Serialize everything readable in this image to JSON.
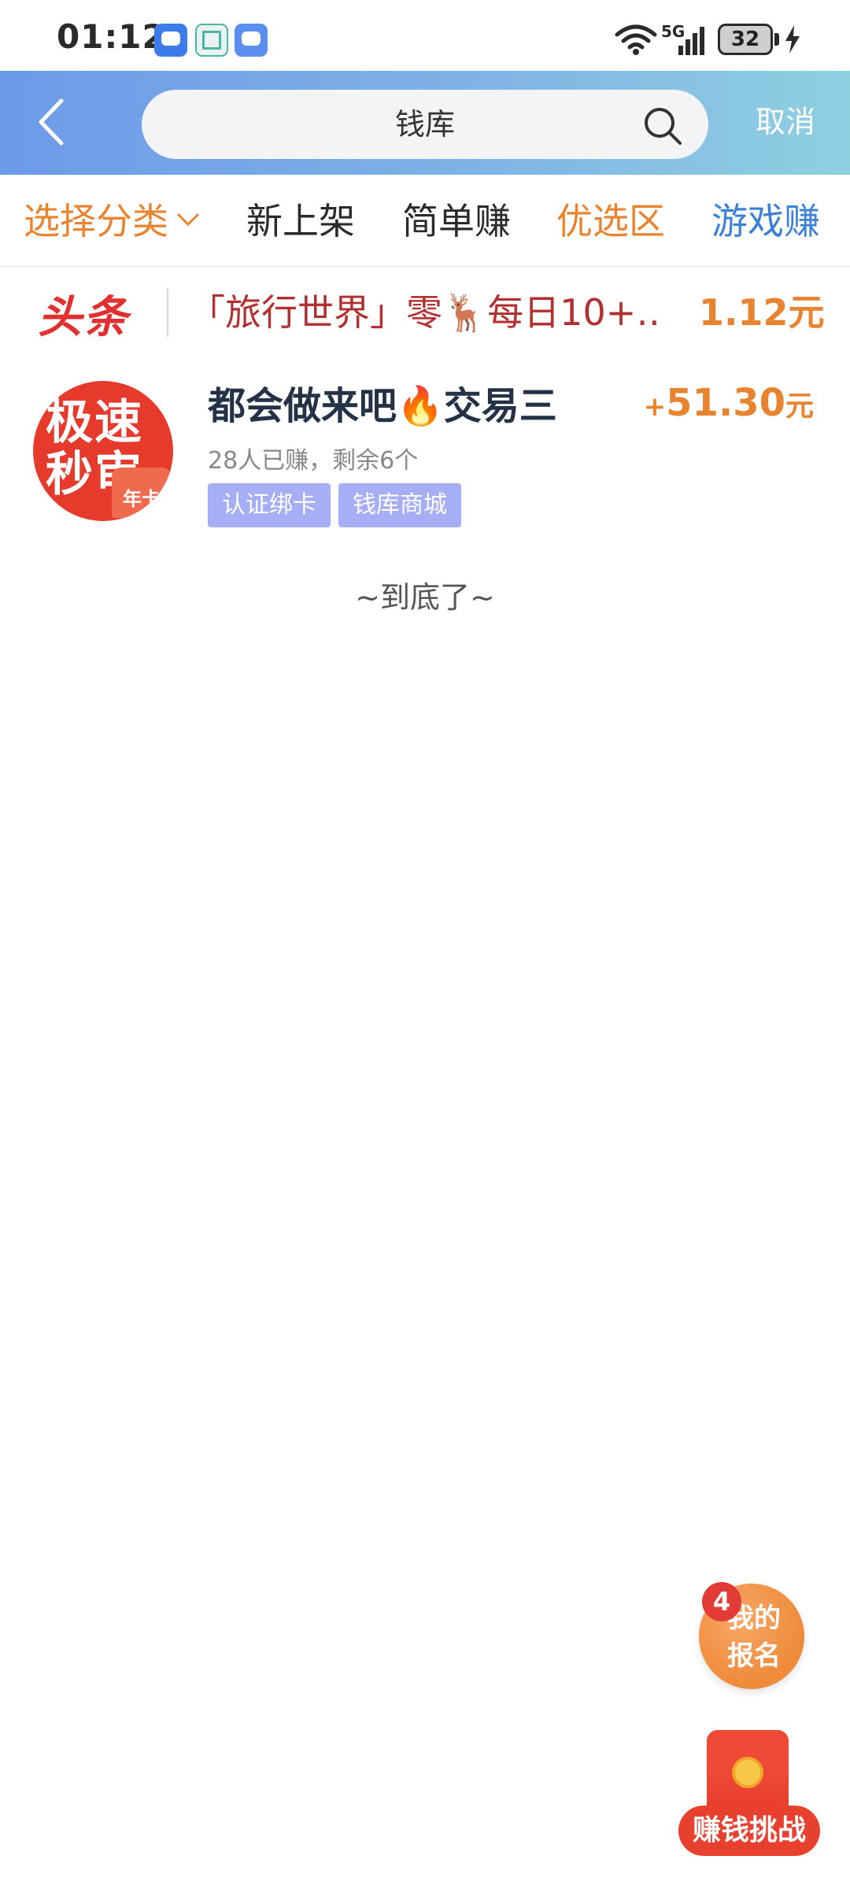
{
  "status_bar": {
    "time": "01:12",
    "network": "5G",
    "battery": "32"
  },
  "header": {
    "search_value": "钱库",
    "cancel_label": "取消"
  },
  "tabs": {
    "select_category": "选择分类",
    "new_listings": "新上架",
    "simple_earn": "简单赚",
    "preferred": "优选区",
    "game_earn": "游戏赚"
  },
  "headline": {
    "logo": "头条",
    "text": "「旅行世界」零🦌每日10+…",
    "price": "1.12元"
  },
  "tasks": [
    {
      "avatar_text": "极速秒审",
      "avatar_badge": "年卡",
      "title": "都会做来吧🔥交易三",
      "reward_sign": "+",
      "reward_amount": "51.30",
      "reward_unit": "元",
      "meta": "28人已赚，剩余6个",
      "tags": [
        "认证绑卡",
        "钱库商城"
      ]
    }
  ],
  "list_end": "~到底了~",
  "floating": {
    "signup_label": "我的报名",
    "signup_badge": "4",
    "challenge_label": "赚钱挑战"
  },
  "colors": {
    "accent_orange": "#e8832f",
    "accent_blue": "#3b82d6",
    "headline_red": "#e03030",
    "tag_purple": "#a6aef5"
  }
}
